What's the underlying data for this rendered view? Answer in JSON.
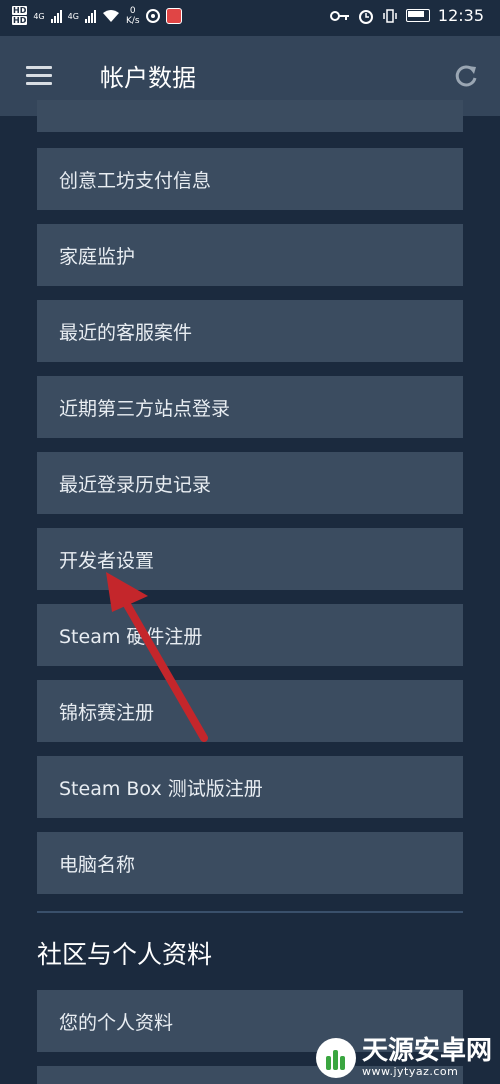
{
  "status_bar": {
    "hd1": "HD",
    "hd2": "HD",
    "net1": "4G",
    "net2": "4G",
    "speed": "0",
    "speed_unit": "K/s",
    "time": "12:35"
  },
  "header": {
    "title": "帐户数据",
    "menu_icon": "hamburger-icon",
    "refresh_icon": "refresh-icon"
  },
  "list_items": [
    "创意工坊支付信息",
    "家庭监护",
    "最近的客服案件",
    "近期第三方站点登录",
    "最近登录历史记录",
    "开发者设置",
    "Steam 硬件注册",
    "锦标赛注册",
    "Steam Box 测试版注册",
    "电脑名称"
  ],
  "section": {
    "title": "社区与个人资料",
    "items": [
      "您的个人资料"
    ]
  },
  "watermark": {
    "name": "天源安卓网",
    "url": "www.jytyaz.com"
  },
  "colors": {
    "background": "#1b2a3e",
    "header": "#34455a",
    "item": "#3b4c60",
    "arrow": "#c4262b"
  }
}
